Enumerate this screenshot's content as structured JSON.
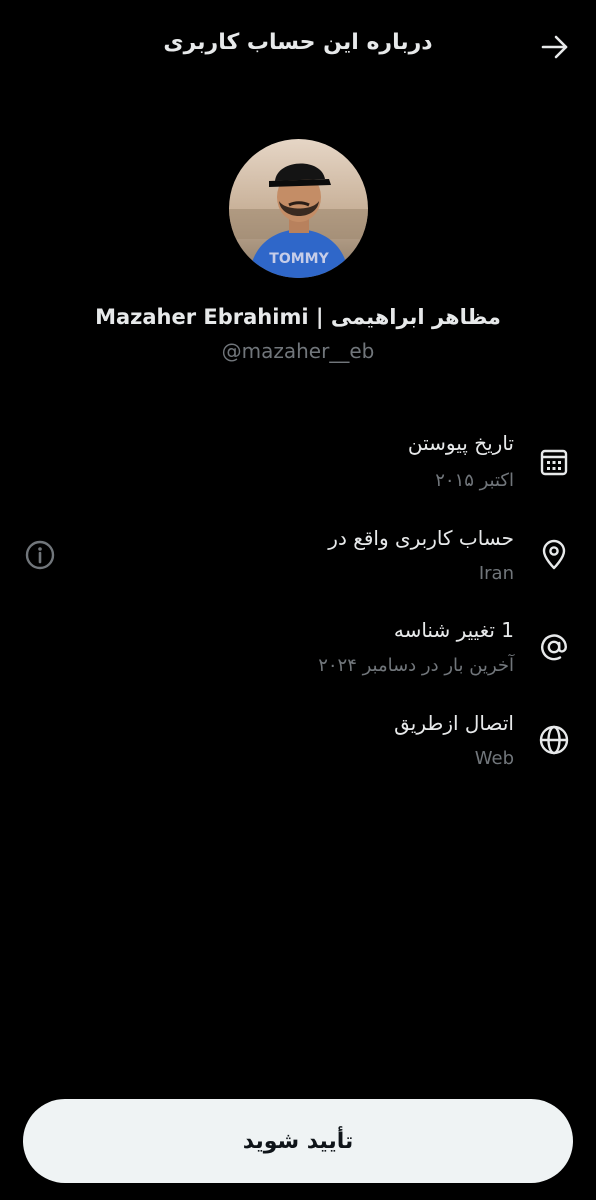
{
  "header": {
    "title": "درباره این حساب کاربری",
    "back_icon": "arrow-right-icon"
  },
  "profile": {
    "display_name": "Mazaher Ebrahimi | مظاهر ابراهیمی",
    "handle": "@mazaher__eb",
    "avatar_shirt_text": "TOMMY"
  },
  "rows": [
    {
      "icon": "calendar-icon",
      "title": "تاریخ پیوستن",
      "subtitle": "اکتبر ۲۰۱۵"
    },
    {
      "icon": "location-pin-icon",
      "title": "حساب کاربری واقع در",
      "subtitle": "Iran",
      "side_icon": "info-icon"
    },
    {
      "icon": "at-sign-icon",
      "title": "1 تغییر شناسه",
      "subtitle": "آخرین بار در دسامبر ۲۰۲۴"
    },
    {
      "icon": "globe-icon",
      "title": "اتصال ازطریق",
      "subtitle": "Web"
    }
  ],
  "footer": {
    "confirm_label": "تأیید شوید"
  },
  "colors": {
    "background": "#000000",
    "primary_text": "#e7e9ea",
    "secondary_text": "#71767b",
    "button_bg": "#eff3f4",
    "button_text": "#0f1419"
  }
}
